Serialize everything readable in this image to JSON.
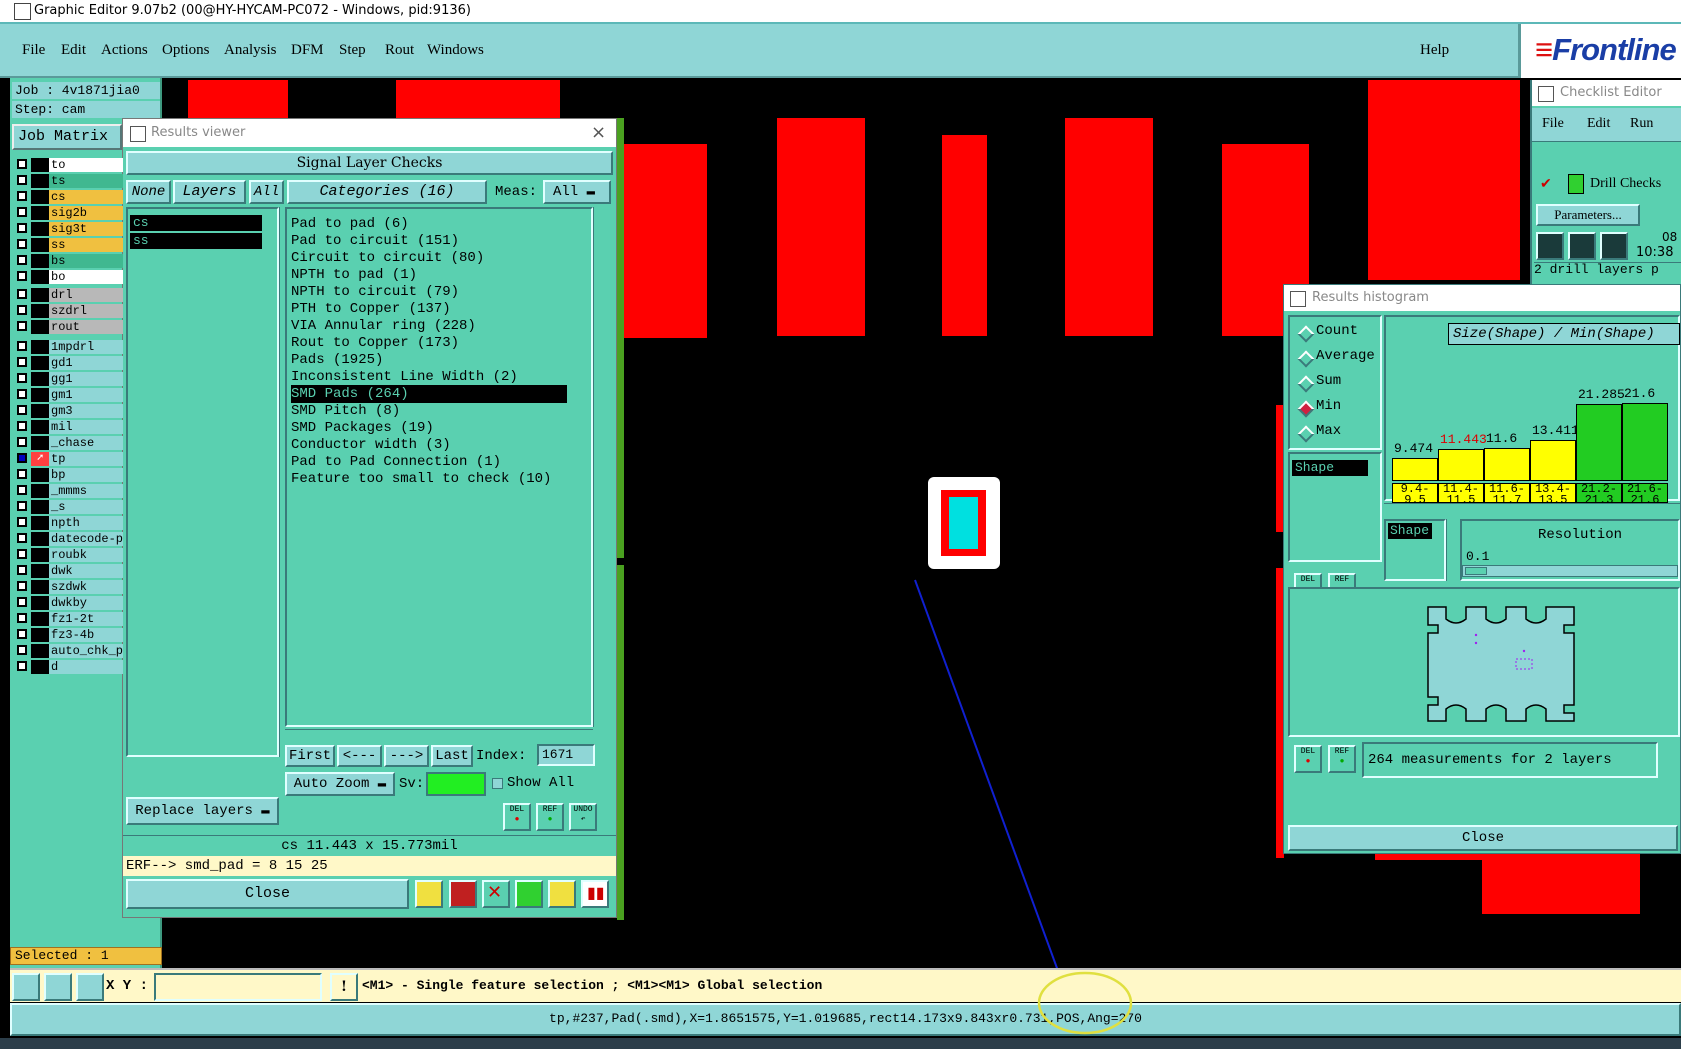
{
  "window": {
    "title": "Graphic Editor 9.07b2 (00@HY-HYCAM-PC072 - Windows, pid:9136)"
  },
  "menubar": {
    "items": [
      "File",
      "Edit",
      "Actions",
      "Options",
      "Analysis",
      "DFM",
      "Step",
      "Rout",
      "Windows"
    ],
    "help": "Help",
    "brand": "Frontline"
  },
  "left": {
    "job": "Job : 4v1871jia0",
    "step": "Step: cam",
    "job_matrix": "Job Matrix",
    "layers": [
      {
        "name": "to",
        "color": "#ffffff"
      },
      {
        "name": "ts",
        "color": "#40b890"
      },
      {
        "name": "cs",
        "color": "#f0c040"
      },
      {
        "name": "sig2b",
        "color": "#f0c040"
      },
      {
        "name": "sig3t",
        "color": "#f0c040"
      },
      {
        "name": "ss",
        "color": "#f0c040"
      },
      {
        "name": "bs",
        "color": "#40b890"
      },
      {
        "name": "bo",
        "color": "#ffffff"
      },
      {
        "name": "drl",
        "color": "#b8b8b8"
      },
      {
        "name": "szdrl",
        "color": "#b8b8b8"
      },
      {
        "name": "rout",
        "color": "#b8b8b8"
      },
      {
        "name": "1mpdrl",
        "color": "#8fd6d6"
      },
      {
        "name": "gd1",
        "color": "#8fd6d6"
      },
      {
        "name": "gg1",
        "color": "#8fd6d6"
      },
      {
        "name": "gm1",
        "color": "#8fd6d6"
      },
      {
        "name": "gm3",
        "color": "#8fd6d6"
      },
      {
        "name": "mil",
        "color": "#8fd6d6"
      },
      {
        "name": "_chase",
        "color": "#8fd6d6"
      },
      {
        "name": "tp",
        "color": "#8fd6d6"
      },
      {
        "name": "bp",
        "color": "#8fd6d6"
      },
      {
        "name": "_mmms",
        "color": "#8fd6d6"
      },
      {
        "name": "_s",
        "color": "#8fd6d6"
      },
      {
        "name": "npth",
        "color": "#8fd6d6"
      },
      {
        "name": "datecode-p",
        "color": "#8fd6d6"
      },
      {
        "name": "roubk",
        "color": "#8fd6d6"
      },
      {
        "name": "dwk",
        "color": "#8fd6d6"
      },
      {
        "name": "szdwk",
        "color": "#8fd6d6"
      },
      {
        "name": "dwkby",
        "color": "#8fd6d6"
      },
      {
        "name": "fz1-2t",
        "color": "#8fd6d6"
      },
      {
        "name": "fz3-4b",
        "color": "#8fd6d6"
      },
      {
        "name": "auto_chk_p",
        "color": "#8fd6d6"
      },
      {
        "name": "d",
        "color": "#8fd6d6"
      }
    ],
    "selected": "Selected : 1"
  },
  "results_viewer": {
    "title": "Results viewer",
    "heading": "Signal Layer Checks",
    "none_btn": "None",
    "layers_btn": "Layers",
    "all_btn": "All",
    "categories_btn": "Categories (16)",
    "meas_label": "Meas:",
    "meas_value": "All",
    "layer_items": [
      "cs",
      "ss"
    ],
    "categories": [
      "Pad to pad (6)",
      "Pad to circuit (151)",
      "Circuit to circuit (80)",
      "NPTH to pad (1)",
      "NPTH to circuit (79)",
      "PTH to Copper (137)",
      "VIA Annular ring (228)",
      "Rout to Copper (173)",
      "Pads (1925)",
      "Inconsistent Line Width (2)",
      "SMD Pads (264)",
      "SMD Pitch (8)",
      "SMD Packages (19)",
      "Conductor width (3)",
      "Pad to Pad Connection (1)",
      "Feature too small to check (10)"
    ],
    "selected_category": "SMD Pads (264)",
    "first_btn": "First",
    "prev_btn": "<---",
    "next_btn": "--->",
    "last_btn": "Last",
    "index_label": "Index:",
    "index_value": "1671",
    "auto_zoom": "Auto Zoom",
    "sv_label": "Sv:",
    "show_all": "Show All",
    "replace_layers": "Replace layers",
    "del": "DEL",
    "ref": "REF",
    "undo": "UNDO",
    "measure_text": "cs 11.443 x 15.773mil",
    "erf_text": "ERF--> smd_pad = 8 15 25",
    "close": "Close"
  },
  "checklist_editor": {
    "title": "Checklist Editor",
    "menu": [
      "File",
      "Edit",
      "Run"
    ],
    "check_name": "Drill Checks",
    "params_btn": "Parameters...",
    "time_top": "08",
    "time": "10:38",
    "status_line": "2 drill layers p"
  },
  "histogram": {
    "title": "Results histogram",
    "options": [
      "Count",
      "Average",
      "Sum",
      "Min",
      "Max"
    ],
    "selected_option": "Min",
    "list_item": "Shape",
    "title_box": "Size(Shape) / Min(Shape)",
    "chart_data": {
      "type": "bar",
      "categories": [
        "9.4-9.5",
        "11.4-11.5",
        "11.6-11.7",
        "13.4-13.5",
        "21.2-21.3",
        "21.6-"
      ],
      "values": [
        9.474,
        11.443,
        11.6,
        13.411,
        21.285,
        21.6
      ],
      "value_labels": [
        "9.474",
        "11.443",
        "11.6",
        "13.411",
        "21.285",
        "21.6"
      ],
      "bin_top": [
        "9.4-",
        "11.4-",
        "11.6-",
        "13.4-",
        "21.2-",
        "21.6-"
      ],
      "bin_bottom": [
        "9.5",
        "11.5",
        "11.7",
        "13.5",
        "21.3",
        "21.6"
      ],
      "highlight_index": 1,
      "colors": [
        "#ffff00",
        "#ffff00",
        "#ffff00",
        "#ffff00",
        "#22cc22",
        "#22cc22"
      ]
    },
    "shape_label": "Shape",
    "resolution_label": "Resolution",
    "resolution_value": "0.1",
    "del": "DEL",
    "ref": "REF",
    "measurements": "264 measurements for 2 layers",
    "close": "Close"
  },
  "command": {
    "xy_label": "X Y :",
    "xy_value": "",
    "hint": "<M1> - Single feature selection ; <M1><M1> Global selection"
  },
  "status": {
    "text": "tp,#237,Pad(.smd),X=1.8651575,Y=1.019685,rect14.173x9.843xr0.731,POS,Ang=270"
  },
  "colors": {
    "accent": "#5ad0b0",
    "panel": "#8fd6d6",
    "pad": "#ff0000",
    "selection_ring": "#e0e040"
  }
}
